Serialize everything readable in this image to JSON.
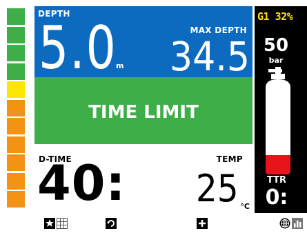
{
  "ascent_rate_bar": {
    "segments": [
      {
        "color": "#3eae49"
      },
      {
        "color": "#3eae49"
      },
      {
        "color": "#3eae49"
      },
      {
        "color": "#3eae49"
      },
      {
        "color": "#ffe600"
      },
      {
        "color": "#f39214"
      },
      {
        "color": "#f39214"
      },
      {
        "color": "#f39214"
      },
      {
        "color": "#f39214"
      },
      {
        "color": "#f39214"
      },
      {
        "color": "#f39214"
      }
    ]
  },
  "depth": {
    "label": "DEPTH",
    "value": "5.0",
    "unit": "m",
    "max_label": "MAX DEPTH",
    "max_value": "34.5",
    "color": "#0d6bbf"
  },
  "alert": {
    "text": "TIME LIMIT",
    "color": "#3eae49"
  },
  "dive_time": {
    "label": "D-TIME",
    "value": "40:"
  },
  "temperature": {
    "label": "TEMP",
    "value": "25",
    "unit": "°C"
  },
  "gas": {
    "label": "G1 32%",
    "label_color": "#ffe600",
    "pressure": "50",
    "pressure_unit": "bar",
    "tank_fill_color": "#e8141b",
    "ttr_label": "TTR",
    "ttr_value": "0:"
  },
  "bottom_bar": {
    "icons": [
      "light-icon",
      "grid-icon",
      "rotate-icon",
      "plus-icon",
      "globe-icon",
      "bar-chart-icon"
    ]
  }
}
